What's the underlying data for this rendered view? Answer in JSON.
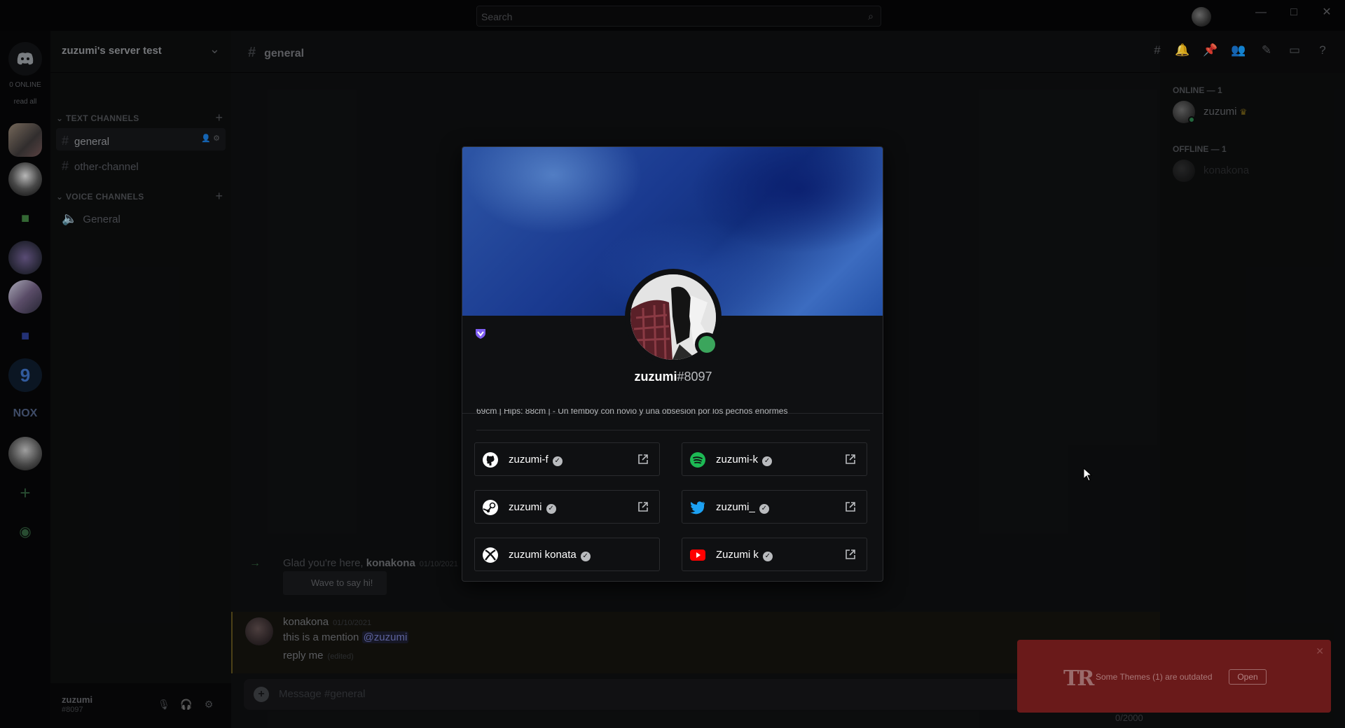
{
  "titlebar": {
    "search_placeholder": "Search",
    "minimize": "—",
    "maximize": "□",
    "close": "✕"
  },
  "rail": {
    "online_label": "0 ONLINE",
    "read_all": "read all",
    "nox_label": "NOX"
  },
  "server": {
    "name": "zuzumi's server test",
    "text_category": "TEXT CHANNELS",
    "voice_category": "VOICE CHANNELS",
    "text_channels": [
      "general",
      "other-channel"
    ],
    "voice_channels": [
      "General"
    ]
  },
  "user_panel": {
    "name": "zuzumi",
    "tag": "#8097"
  },
  "chat": {
    "channel": "general",
    "system_prefix": "Glad you're here, ",
    "system_user": "konakona",
    "system_time": "01/10/2021",
    "wave_label": "Wave to say hi!",
    "author": "konakona",
    "author_time": "01/10/2021",
    "line1_text": "this is a mention ",
    "line1_mention": "@zuzumi",
    "line2_text": "reply me",
    "line2_edited": "(edited)",
    "composer_placeholder": "Message #general",
    "char_count": "0/2000"
  },
  "members": {
    "online_header": "ONLINE — 1",
    "offline_header": "OFFLINE — 1",
    "online": [
      {
        "name": "zuzumi"
      }
    ],
    "offline": [
      {
        "name": "konakona"
      }
    ]
  },
  "profile": {
    "username": "zuzumi",
    "discriminator": "#8097",
    "bio": "69cm | Hips: 88cm | - Un femboy con novio y una obsesión por los pechos enormes",
    "connections": [
      {
        "service": "github",
        "name": "zuzumi-f"
      },
      {
        "service": "spotify",
        "name": "zuzumi-k"
      },
      {
        "service": "steam",
        "name": "zuzumi"
      },
      {
        "service": "twitter",
        "name": "zuzumi_"
      },
      {
        "service": "xbox",
        "name": "zuzumi konata"
      },
      {
        "service": "youtube",
        "name": "Zuzumi k"
      }
    ],
    "colors": {
      "status_online": "#3ba55c",
      "badge": "#7f5ef3"
    }
  },
  "toast": {
    "logo": "TR",
    "message": "Some Themes (1) are outdated",
    "button": "Open",
    "close": "✕"
  }
}
